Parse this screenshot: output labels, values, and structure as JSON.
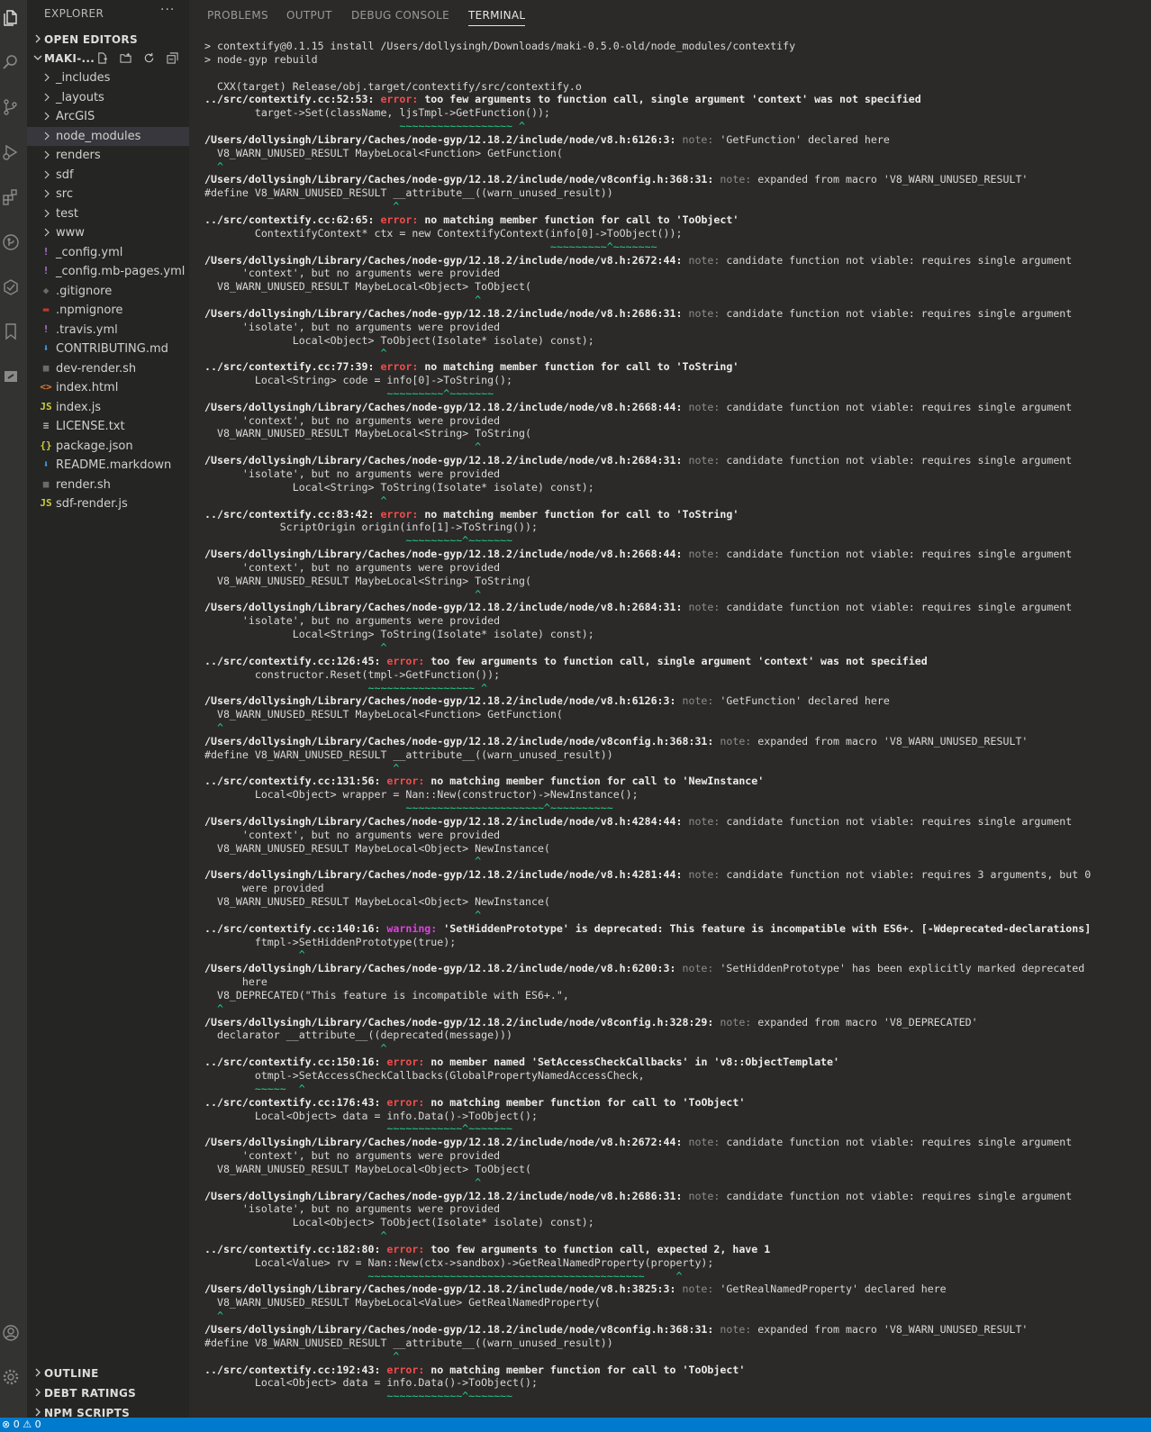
{
  "colors": {
    "activity_bar": "#333331",
    "sidebar": "#252523",
    "panel": "#2b2a28",
    "error": "#f14c4c",
    "warning": "#e040e0",
    "note": "#8c8c8c",
    "squiggle": "#23d18b",
    "status_bar": "#007acc",
    "selected_row": "#37373d"
  },
  "activity_bar": {
    "icons": [
      "files-icon",
      "search-icon",
      "source-control-icon",
      "run-debug-icon",
      "extensions-icon",
      "git-lens-icon",
      "test-icon",
      "bookmark-icon",
      "remote-icon",
      "account-icon",
      "gear-icon"
    ]
  },
  "explorer": {
    "title": "EXPLORER",
    "more": "···",
    "open_editors": "OPEN EDITORS",
    "project": "MAKI-...",
    "items": [
      {
        "name": "_includes",
        "type": "folder"
      },
      {
        "name": "_layouts",
        "type": "folder"
      },
      {
        "name": "ArcGIS",
        "type": "folder"
      },
      {
        "name": "node_modules",
        "type": "folder",
        "selected": true
      },
      {
        "name": "renders",
        "type": "folder"
      },
      {
        "name": "sdf",
        "type": "folder"
      },
      {
        "name": "src",
        "type": "folder"
      },
      {
        "name": "test",
        "type": "folder"
      },
      {
        "name": "www",
        "type": "folder"
      },
      {
        "name": "_config.yml",
        "type": "yml"
      },
      {
        "name": "_config.mb-pages.yml",
        "type": "yml"
      },
      {
        "name": ".gitignore",
        "type": "git"
      },
      {
        "name": ".npmignore",
        "type": "npm"
      },
      {
        "name": ".travis.yml",
        "type": "yml"
      },
      {
        "name": "CONTRIBUTING.md",
        "type": "md"
      },
      {
        "name": "dev-render.sh",
        "type": "sh"
      },
      {
        "name": "index.html",
        "type": "html"
      },
      {
        "name": "index.js",
        "type": "js"
      },
      {
        "name": "LICENSE.txt",
        "type": "txt"
      },
      {
        "name": "package.json",
        "type": "json"
      },
      {
        "name": "README.markdown",
        "type": "md"
      },
      {
        "name": "render.sh",
        "type": "sh"
      },
      {
        "name": "sdf-render.js",
        "type": "js"
      }
    ],
    "outline": "OUTLINE",
    "debt_ratings": "DEBT RATINGS",
    "npm_scripts": "NPM SCRIPTS"
  },
  "panel": {
    "tabs": [
      "PROBLEMS",
      "OUTPUT",
      "DEBUG CONSOLE",
      "TERMINAL"
    ],
    "active_tab": "TERMINAL"
  },
  "terminal": {
    "lines": [
      [
        {
          "t": "> contextify@0.1.15 install /Users/dollysingh/Downloads/maki-0.5.0-old/node_modules/contextify"
        }
      ],
      [
        {
          "t": "> node-gyp rebuild"
        }
      ],
      [
        {
          "t": ""
        }
      ],
      [
        {
          "t": "  CXX(target) Release/obj.target/contextify/src/contextify.o"
        }
      ],
      [
        {
          "t": "../src/contextify.cc:52:53: ",
          "c": "b"
        },
        {
          "t": "error: ",
          "c": "err"
        },
        {
          "t": "too few arguments to function call, single argument 'context' was not specified",
          "c": "b"
        }
      ],
      [
        {
          "t": "        target->Set(className, ljsTmpl->GetFunction());"
        }
      ],
      [
        {
          "t": "                               ~~~~~~~~~~~~~~~~~~ ^",
          "c": "sq"
        }
      ],
      [
        {
          "t": "/Users/dollysingh/Library/Caches/node-gyp/12.18.2/include/node/v8.h:6126:3: ",
          "c": "b"
        },
        {
          "t": "note: ",
          "c": "note"
        },
        {
          "t": "'GetFunction' declared here"
        }
      ],
      [
        {
          "t": "  V8_WARN_UNUSED_RESULT MaybeLocal<Function> GetFunction("
        }
      ],
      [
        {
          "t": "  ^",
          "c": "sq"
        }
      ],
      [
        {
          "t": "/Users/dollysingh/Library/Caches/node-gyp/12.18.2/include/node/v8config.h:368:31: ",
          "c": "b"
        },
        {
          "t": "note: ",
          "c": "note"
        },
        {
          "t": "expanded from macro 'V8_WARN_UNUSED_RESULT'"
        }
      ],
      [
        {
          "t": "#define V8_WARN_UNUSED_RESULT __attribute__((warn_unused_result))"
        }
      ],
      [
        {
          "t": "                              ^",
          "c": "sq"
        }
      ],
      [
        {
          "t": "../src/contextify.cc:62:65: ",
          "c": "b"
        },
        {
          "t": "error: ",
          "c": "err"
        },
        {
          "t": "no matching member function for call to 'ToObject'",
          "c": "b"
        }
      ],
      [
        {
          "t": "        ContextifyContext* ctx = new ContextifyContext(info[0]->ToObject());"
        }
      ],
      [
        {
          "t": "                                                       ~~~~~~~~~^~~~~~~~",
          "c": "sq"
        }
      ],
      [
        {
          "t": "/Users/dollysingh/Library/Caches/node-gyp/12.18.2/include/node/v8.h:2672:44: ",
          "c": "b"
        },
        {
          "t": "note: ",
          "c": "note"
        },
        {
          "t": "candidate function not viable: requires single argument"
        }
      ],
      [
        {
          "t": "      'context', but no arguments were provided"
        }
      ],
      [
        {
          "t": "  V8_WARN_UNUSED_RESULT MaybeLocal<Object> ToObject("
        }
      ],
      [
        {
          "t": "                                           ^",
          "c": "sq"
        }
      ],
      [
        {
          "t": "/Users/dollysingh/Library/Caches/node-gyp/12.18.2/include/node/v8.h:2686:31: ",
          "c": "b"
        },
        {
          "t": "note: ",
          "c": "note"
        },
        {
          "t": "candidate function not viable: requires single argument"
        }
      ],
      [
        {
          "t": "      'isolate', but no arguments were provided"
        }
      ],
      [
        {
          "t": "              Local<Object> ToObject(Isolate* isolate) const);"
        }
      ],
      [
        {
          "t": "                            ^",
          "c": "sq"
        }
      ],
      [
        {
          "t": "../src/contextify.cc:77:39: ",
          "c": "b"
        },
        {
          "t": "error: ",
          "c": "err"
        },
        {
          "t": "no matching member function for call to 'ToString'",
          "c": "b"
        }
      ],
      [
        {
          "t": "        Local<String> code = info[0]->ToString();"
        }
      ],
      [
        {
          "t": "                             ~~~~~~~~~^~~~~~~~",
          "c": "sq"
        }
      ],
      [
        {
          "t": "/Users/dollysingh/Library/Caches/node-gyp/12.18.2/include/node/v8.h:2668:44: ",
          "c": "b"
        },
        {
          "t": "note: ",
          "c": "note"
        },
        {
          "t": "candidate function not viable: requires single argument"
        }
      ],
      [
        {
          "t": "      'context', but no arguments were provided"
        }
      ],
      [
        {
          "t": "  V8_WARN_UNUSED_RESULT MaybeLocal<String> ToString("
        }
      ],
      [
        {
          "t": "                                           ^",
          "c": "sq"
        }
      ],
      [
        {
          "t": "/Users/dollysingh/Library/Caches/node-gyp/12.18.2/include/node/v8.h:2684:31: ",
          "c": "b"
        },
        {
          "t": "note: ",
          "c": "note"
        },
        {
          "t": "candidate function not viable: requires single argument"
        }
      ],
      [
        {
          "t": "      'isolate', but no arguments were provided"
        }
      ],
      [
        {
          "t": "              Local<String> ToString(Isolate* isolate) const);"
        }
      ],
      [
        {
          "t": "                            ^",
          "c": "sq"
        }
      ],
      [
        {
          "t": "../src/contextify.cc:83:42: ",
          "c": "b"
        },
        {
          "t": "error: ",
          "c": "err"
        },
        {
          "t": "no matching member function for call to 'ToString'",
          "c": "b"
        }
      ],
      [
        {
          "t": "            ScriptOrigin origin(info[1]->ToString());"
        }
      ],
      [
        {
          "t": "                                ~~~~~~~~~^~~~~~~~",
          "c": "sq"
        }
      ],
      [
        {
          "t": "/Users/dollysingh/Library/Caches/node-gyp/12.18.2/include/node/v8.h:2668:44: ",
          "c": "b"
        },
        {
          "t": "note: ",
          "c": "note"
        },
        {
          "t": "candidate function not viable: requires single argument"
        }
      ],
      [
        {
          "t": "      'context', but no arguments were provided"
        }
      ],
      [
        {
          "t": "  V8_WARN_UNUSED_RESULT MaybeLocal<String> ToString("
        }
      ],
      [
        {
          "t": "                                           ^",
          "c": "sq"
        }
      ],
      [
        {
          "t": "/Users/dollysingh/Library/Caches/node-gyp/12.18.2/include/node/v8.h:2684:31: ",
          "c": "b"
        },
        {
          "t": "note: ",
          "c": "note"
        },
        {
          "t": "candidate function not viable: requires single argument"
        }
      ],
      [
        {
          "t": "      'isolate', but no arguments were provided"
        }
      ],
      [
        {
          "t": "              Local<String> ToString(Isolate* isolate) const);"
        }
      ],
      [
        {
          "t": "                            ^",
          "c": "sq"
        }
      ],
      [
        {
          "t": "../src/contextify.cc:126:45: ",
          "c": "b"
        },
        {
          "t": "error: ",
          "c": "err"
        },
        {
          "t": "too few arguments to function call, single argument 'context' was not specified",
          "c": "b"
        }
      ],
      [
        {
          "t": "        constructor.Reset(tmpl->GetFunction());"
        }
      ],
      [
        {
          "t": "                          ~~~~~~~~~~~~~~~~~ ^",
          "c": "sq"
        }
      ],
      [
        {
          "t": "/Users/dollysingh/Library/Caches/node-gyp/12.18.2/include/node/v8.h:6126:3: ",
          "c": "b"
        },
        {
          "t": "note: ",
          "c": "note"
        },
        {
          "t": "'GetFunction' declared here"
        }
      ],
      [
        {
          "t": "  V8_WARN_UNUSED_RESULT MaybeLocal<Function> GetFunction("
        }
      ],
      [
        {
          "t": "  ^",
          "c": "sq"
        }
      ],
      [
        {
          "t": "/Users/dollysingh/Library/Caches/node-gyp/12.18.2/include/node/v8config.h:368:31: ",
          "c": "b"
        },
        {
          "t": "note: ",
          "c": "note"
        },
        {
          "t": "expanded from macro 'V8_WARN_UNUSED_RESULT'"
        }
      ],
      [
        {
          "t": "#define V8_WARN_UNUSED_RESULT __attribute__((warn_unused_result))"
        }
      ],
      [
        {
          "t": "                              ^",
          "c": "sq"
        }
      ],
      [
        {
          "t": "../src/contextify.cc:131:56: ",
          "c": "b"
        },
        {
          "t": "error: ",
          "c": "err"
        },
        {
          "t": "no matching member function for call to 'NewInstance'",
          "c": "b"
        }
      ],
      [
        {
          "t": "        Local<Object> wrapper = Nan::New(constructor)->NewInstance();"
        }
      ],
      [
        {
          "t": "                                ~~~~~~~~~~~~~~~~~~~~~~^~~~~~~~~~~",
          "c": "sq"
        }
      ],
      [
        {
          "t": "/Users/dollysingh/Library/Caches/node-gyp/12.18.2/include/node/v8.h:4284:44: ",
          "c": "b"
        },
        {
          "t": "note: ",
          "c": "note"
        },
        {
          "t": "candidate function not viable: requires single argument"
        }
      ],
      [
        {
          "t": "      'context', but no arguments were provided"
        }
      ],
      [
        {
          "t": "  V8_WARN_UNUSED_RESULT MaybeLocal<Object> NewInstance("
        }
      ],
      [
        {
          "t": "                                           ^",
          "c": "sq"
        }
      ],
      [
        {
          "t": "/Users/dollysingh/Library/Caches/node-gyp/12.18.2/include/node/v8.h:4281:44: ",
          "c": "b"
        },
        {
          "t": "note: ",
          "c": "note"
        },
        {
          "t": "candidate function not viable: requires 3 arguments, but 0"
        }
      ],
      [
        {
          "t": "      were provided"
        }
      ],
      [
        {
          "t": "  V8_WARN_UNUSED_RESULT MaybeLocal<Object> NewInstance("
        }
      ],
      [
        {
          "t": "                                           ^",
          "c": "sq"
        }
      ],
      [
        {
          "t": "../src/contextify.cc:140:16: ",
          "c": "b"
        },
        {
          "t": "warning: ",
          "c": "warn"
        },
        {
          "t": "'SetHiddenPrototype' is deprecated: This feature is incompatible with ES6+. [-Wdeprecated-declarations]",
          "c": "b"
        }
      ],
      [
        {
          "t": "        ftmpl->SetHiddenPrototype(true);"
        }
      ],
      [
        {
          "t": "               ^",
          "c": "sq"
        }
      ],
      [
        {
          "t": "/Users/dollysingh/Library/Caches/node-gyp/12.18.2/include/node/v8.h:6200:3: ",
          "c": "b"
        },
        {
          "t": "note: ",
          "c": "note"
        },
        {
          "t": "'SetHiddenPrototype' has been explicitly marked deprecated"
        }
      ],
      [
        {
          "t": "      here"
        }
      ],
      [
        {
          "t": "  V8_DEPRECATED(\"This feature is incompatible with ES6+.\","
        }
      ],
      [
        {
          "t": "  ^",
          "c": "sq"
        }
      ],
      [
        {
          "t": "/Users/dollysingh/Library/Caches/node-gyp/12.18.2/include/node/v8config.h:328:29: ",
          "c": "b"
        },
        {
          "t": "note: ",
          "c": "note"
        },
        {
          "t": "expanded from macro 'V8_DEPRECATED'"
        }
      ],
      [
        {
          "t": "  declarator __attribute__((deprecated(message)))"
        }
      ],
      [
        {
          "t": "                            ^",
          "c": "sq"
        }
      ],
      [
        {
          "t": "../src/contextify.cc:150:16: ",
          "c": "b"
        },
        {
          "t": "error: ",
          "c": "err"
        },
        {
          "t": "no member named 'SetAccessCheckCallbacks' in 'v8::ObjectTemplate'",
          "c": "b"
        }
      ],
      [
        {
          "t": "        otmpl->SetAccessCheckCallbacks(GlobalPropertyNamedAccessCheck,"
        }
      ],
      [
        {
          "t": "        ~~~~~  ^",
          "c": "sq"
        }
      ],
      [
        {
          "t": "../src/contextify.cc:176:43: ",
          "c": "b"
        },
        {
          "t": "error: ",
          "c": "err"
        },
        {
          "t": "no matching member function for call to 'ToObject'",
          "c": "b"
        }
      ],
      [
        {
          "t": "        Local<Object> data = info.Data()->ToObject();"
        }
      ],
      [
        {
          "t": "                             ~~~~~~~~~~~~^~~~~~~~",
          "c": "sq"
        }
      ],
      [
        {
          "t": "/Users/dollysingh/Library/Caches/node-gyp/12.18.2/include/node/v8.h:2672:44: ",
          "c": "b"
        },
        {
          "t": "note: ",
          "c": "note"
        },
        {
          "t": "candidate function not viable: requires single argument"
        }
      ],
      [
        {
          "t": "      'context', but no arguments were provided"
        }
      ],
      [
        {
          "t": "  V8_WARN_UNUSED_RESULT MaybeLocal<Object> ToObject("
        }
      ],
      [
        {
          "t": "                                           ^",
          "c": "sq"
        }
      ],
      [
        {
          "t": "/Users/dollysingh/Library/Caches/node-gyp/12.18.2/include/node/v8.h:2686:31: ",
          "c": "b"
        },
        {
          "t": "note: ",
          "c": "note"
        },
        {
          "t": "candidate function not viable: requires single argument"
        }
      ],
      [
        {
          "t": "      'isolate', but no arguments were provided"
        }
      ],
      [
        {
          "t": "              Local<Object> ToObject(Isolate* isolate) const);"
        }
      ],
      [
        {
          "t": "                            ^",
          "c": "sq"
        }
      ],
      [
        {
          "t": "../src/contextify.cc:182:80: ",
          "c": "b"
        },
        {
          "t": "error: ",
          "c": "err"
        },
        {
          "t": "too few arguments to function call, expected 2, have 1",
          "c": "b"
        }
      ],
      [
        {
          "t": "        Local<Value> rv = Nan::New(ctx->sandbox)->GetRealNamedProperty(property);"
        }
      ],
      [
        {
          "t": "                          ~~~~~~~~~~~~~~~~~~~~~~~~~~~~~~~~~~~~~~~~~~~~     ^",
          "c": "sq"
        }
      ],
      [
        {
          "t": "/Users/dollysingh/Library/Caches/node-gyp/12.18.2/include/node/v8.h:3825:3: ",
          "c": "b"
        },
        {
          "t": "note: ",
          "c": "note"
        },
        {
          "t": "'GetRealNamedProperty' declared here"
        }
      ],
      [
        {
          "t": "  V8_WARN_UNUSED_RESULT MaybeLocal<Value> GetRealNamedProperty("
        }
      ],
      [
        {
          "t": "  ^",
          "c": "sq"
        }
      ],
      [
        {
          "t": "/Users/dollysingh/Library/Caches/node-gyp/12.18.2/include/node/v8config.h:368:31: ",
          "c": "b"
        },
        {
          "t": "note: ",
          "c": "note"
        },
        {
          "t": "expanded from macro 'V8_WARN_UNUSED_RESULT'"
        }
      ],
      [
        {
          "t": "#define V8_WARN_UNUSED_RESULT __attribute__((warn_unused_result))"
        }
      ],
      [
        {
          "t": "                              ^",
          "c": "sq"
        }
      ],
      [
        {
          "t": "../src/contextify.cc:192:43: ",
          "c": "b"
        },
        {
          "t": "error: ",
          "c": "err"
        },
        {
          "t": "no matching member function for call to 'ToObject'",
          "c": "b"
        }
      ],
      [
        {
          "t": "        Local<Object> data = info.Data()->ToObject();"
        }
      ],
      [
        {
          "t": "                             ~~~~~~~~~~~~^~~~~~~~",
          "c": "sq"
        }
      ]
    ]
  },
  "status_bar": {
    "errors": "0",
    "warnings": "0"
  }
}
